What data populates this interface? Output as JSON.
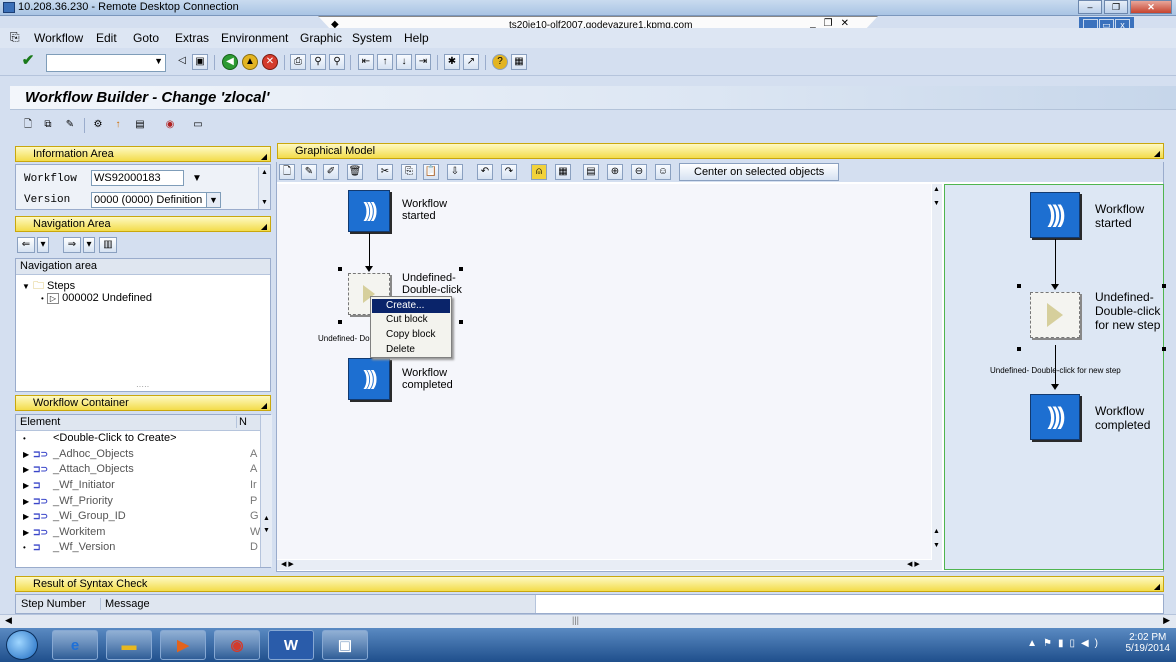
{
  "remote_desktop": {
    "title": "10.208.36.230 - Remote Desktop Connection"
  },
  "connection_bar": {
    "host": "ts20ie10-olf2007.godevazure1.kpmg.com"
  },
  "menu": [
    "Workflow",
    "Edit",
    "Goto",
    "Extras",
    "Environment",
    "Graphic",
    "System",
    "Help"
  ],
  "page_title": "Workflow Builder - Change 'zlocal'",
  "info_area": {
    "header": "Information Area",
    "workflow_label": "Workflow",
    "workflow_value": "WS92000183",
    "version_label": "Version",
    "version_value": "0000 (0000) Definition"
  },
  "navigation_area": {
    "header": "Navigation Area",
    "tree_header": "Navigation area",
    "steps_label": "Steps",
    "step_item": "000002 Undefined"
  },
  "workflow_container": {
    "header": "Workflow Container",
    "col_element": "Element",
    "col_n": "N",
    "rows": [
      {
        "name": "<Double-Click to Create>",
        "col2": ""
      },
      {
        "name": "_Adhoc_Objects",
        "col2": "A"
      },
      {
        "name": "_Attach_Objects",
        "col2": "A"
      },
      {
        "name": "_Wf_Initiator",
        "col2": "Ir"
      },
      {
        "name": "_Wf_Priority",
        "col2": "P"
      },
      {
        "name": "_Wi_Group_ID",
        "col2": "G"
      },
      {
        "name": "_Workitem",
        "col2": "W"
      },
      {
        "name": "_Wf_Version",
        "col2": "D"
      }
    ]
  },
  "graphical_model": {
    "header": "Graphical Model",
    "center_button": "Center on selected objects",
    "left": {
      "start_label": "Workflow started",
      "step_label": "Undefined- Double-click",
      "step_caption": "Undefined- Doub",
      "end_label": "Workflow completed"
    },
    "right": {
      "start_label": "Workflow started",
      "step_label": "Undefined- Double-click for new step",
      "step_caption": "Undefined- Double-click for new step",
      "end_label": "Workflow completed"
    },
    "context_menu": [
      "Create...",
      "Cut block",
      "Copy block",
      "Delete"
    ]
  },
  "syntax_check": {
    "header": "Result of Syntax Check",
    "col_step": "Step Number",
    "col_message": "Message"
  },
  "taskbar": {
    "time": "2:02 PM",
    "date": "5/19/2014"
  }
}
